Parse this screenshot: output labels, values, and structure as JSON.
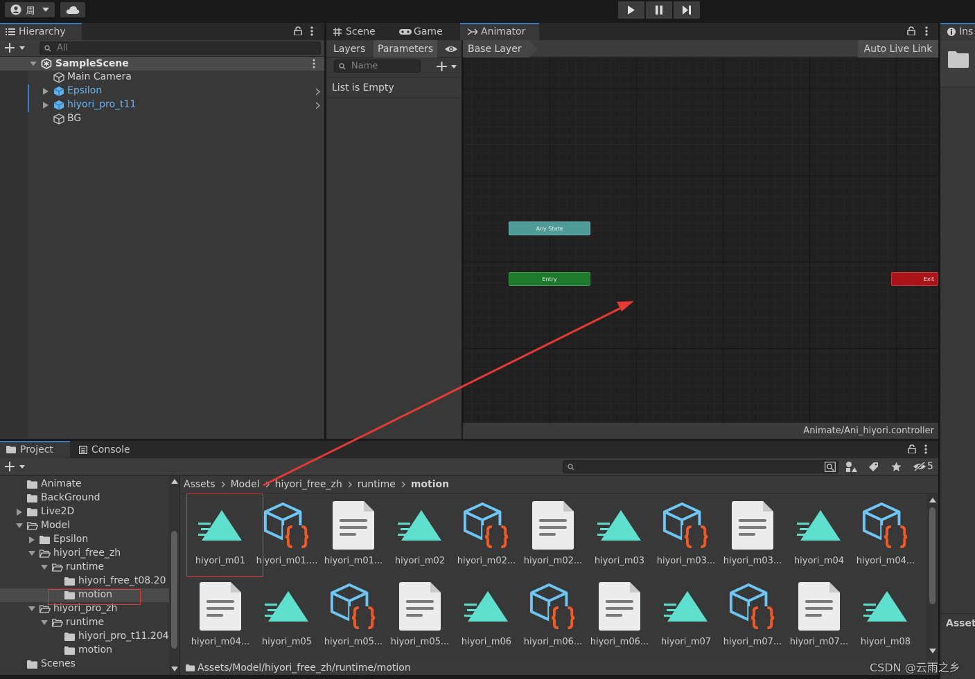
{
  "toolbar": {
    "account_glyph": "周",
    "play": "play-icon",
    "pause": "pause-icon",
    "step": "step-icon"
  },
  "hierarchy": {
    "tab": "Hierarchy",
    "search_placeholder": "All",
    "scene": "SampleScene",
    "items": [
      {
        "label": "Main Camera",
        "prefab": false,
        "expandable": false
      },
      {
        "label": "Epsilon",
        "prefab": true,
        "expandable": true
      },
      {
        "label": "hiyori_pro_t11",
        "prefab": true,
        "expandable": true
      },
      {
        "label": "BG",
        "prefab": false,
        "expandable": false
      }
    ]
  },
  "center_tabs": {
    "scene": "Scene",
    "game": "Game",
    "animator": "Animator"
  },
  "animator": {
    "layers_tab": "Layers",
    "parameters_tab": "Parameters",
    "name_placeholder": "Name",
    "list_empty": "List is Empty",
    "breadcrumb": "Base Layer",
    "auto_live_link": "Auto Live Link",
    "nodes": {
      "any_state": "Any State",
      "entry": "Entry",
      "exit": "Exit"
    },
    "controller_path": "Animate/Ani_hiyori.controller"
  },
  "inspector": {
    "tab": "Ins",
    "asset_label": "Asset"
  },
  "project": {
    "tab": "Project",
    "console_tab": "Console",
    "hidden_count": "5",
    "tree": [
      {
        "label": "Animate",
        "indent": 0,
        "arrow": ""
      },
      {
        "label": "BackGround",
        "indent": 0,
        "arrow": ""
      },
      {
        "label": "Live2D",
        "indent": 0,
        "arrow": "right"
      },
      {
        "label": "Model",
        "indent": 0,
        "arrow": "down",
        "open": true
      },
      {
        "label": "Epsilon",
        "indent": 1,
        "arrow": "right"
      },
      {
        "label": "hiyori_free_zh",
        "indent": 1,
        "arrow": "down",
        "open": true
      },
      {
        "label": "runtime",
        "indent": 2,
        "arrow": "down",
        "open": true
      },
      {
        "label": "hiyori_free_t08.20",
        "indent": 3,
        "arrow": ""
      },
      {
        "label": "motion",
        "indent": 3,
        "arrow": "",
        "selected": true
      },
      {
        "label": "hiyori_pro_zh",
        "indent": 1,
        "arrow": "down",
        "open": true
      },
      {
        "label": "runtime",
        "indent": 2,
        "arrow": "down",
        "open": true
      },
      {
        "label": "hiyori_pro_t11.204",
        "indent": 3,
        "arrow": ""
      },
      {
        "label": "motion",
        "indent": 3,
        "arrow": ""
      },
      {
        "label": "Scenes",
        "indent": 0,
        "arrow": ""
      }
    ],
    "breadcrumb": [
      "Assets",
      "Model",
      "hiyori_free_zh",
      "runtime",
      "motion"
    ],
    "assets": [
      {
        "name": "hiyori_m01",
        "type": "anim"
      },
      {
        "name": "hiyori_m01....",
        "type": "prefab"
      },
      {
        "name": "hiyori_m01...",
        "type": "doc"
      },
      {
        "name": "hiyori_m02",
        "type": "anim"
      },
      {
        "name": "hiyori_m02...",
        "type": "prefab"
      },
      {
        "name": "hiyori_m02...",
        "type": "doc"
      },
      {
        "name": "hiyori_m03",
        "type": "anim"
      },
      {
        "name": "hiyori_m03...",
        "type": "prefab"
      },
      {
        "name": "hiyori_m03...",
        "type": "doc"
      },
      {
        "name": "hiyori_m04",
        "type": "anim"
      },
      {
        "name": "hiyori_m04...",
        "type": "prefab"
      },
      {
        "name": "hiyori_m04...",
        "type": "doc"
      },
      {
        "name": "hiyori_m05",
        "type": "anim"
      },
      {
        "name": "hiyori_m05...",
        "type": "prefab"
      },
      {
        "name": "hiyori_m05...",
        "type": "doc"
      },
      {
        "name": "hiyori_m06",
        "type": "anim"
      },
      {
        "name": "hiyori_m06...",
        "type": "prefab"
      },
      {
        "name": "hiyori_m06...",
        "type": "doc"
      },
      {
        "name": "hiyori_m07",
        "type": "anim"
      },
      {
        "name": "hiyori_m07...",
        "type": "prefab"
      },
      {
        "name": "hiyori_m07...",
        "type": "doc"
      },
      {
        "name": "hiyori_m08",
        "type": "anim"
      }
    ],
    "footer_path": "Assets/Model/hiyori_free_zh/runtime/motion"
  },
  "watermark": "CSDN @云雨之乡",
  "colors": {
    "accent": "#3a79bb",
    "annotation": "#e53935",
    "anim_icon": "#5fe0cf",
    "prefab_icon": "#6ec6f5",
    "prefab_brace": "#f05a28",
    "any_state": "#4f9b96",
    "entry": "#1d7a2d",
    "exit": "#a8141a",
    "prefab_text": "#69b4f2"
  }
}
